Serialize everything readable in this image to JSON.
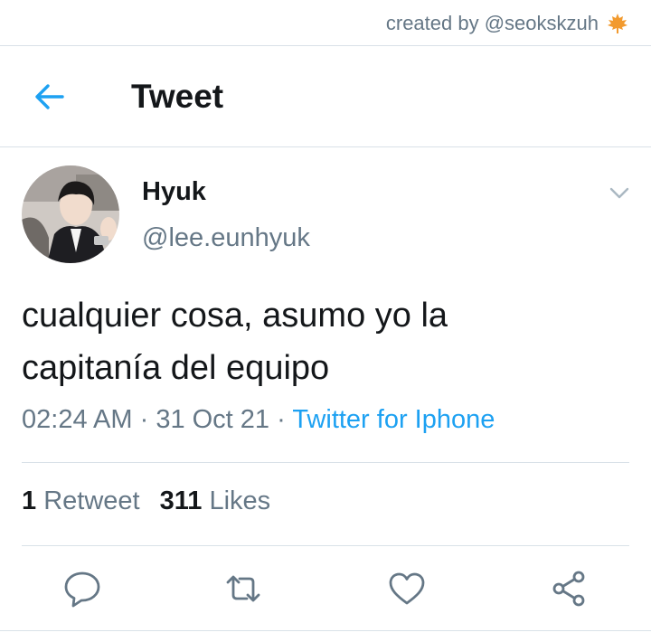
{
  "watermark": {
    "text": "created by @seokskzuh",
    "icon": "maple-leaf-icon"
  },
  "header": {
    "title": "Tweet",
    "back_icon": "back-arrow-icon"
  },
  "tweet": {
    "author_name": "Hyuk",
    "author_handle": "@lee.eunhyuk",
    "text_lines": [
      "cualquier cosa, asumo yo la",
      "capitanía del equipo"
    ],
    "time": "02:24 AM",
    "date": "31 Oct 21",
    "source": "Twitter for Iphone",
    "separator": " · "
  },
  "stats": {
    "retweets_count": "1",
    "retweets_label": "Retweet",
    "likes_count": "311",
    "likes_label": "Likes"
  },
  "actions": [
    "reply-icon",
    "retweet-icon",
    "like-icon",
    "share-icon"
  ],
  "colors": {
    "accent": "#1da1f2",
    "muted": "#657786",
    "text": "#14171a",
    "divider": "#d9e1e8",
    "leaf": "#f29a2e"
  }
}
